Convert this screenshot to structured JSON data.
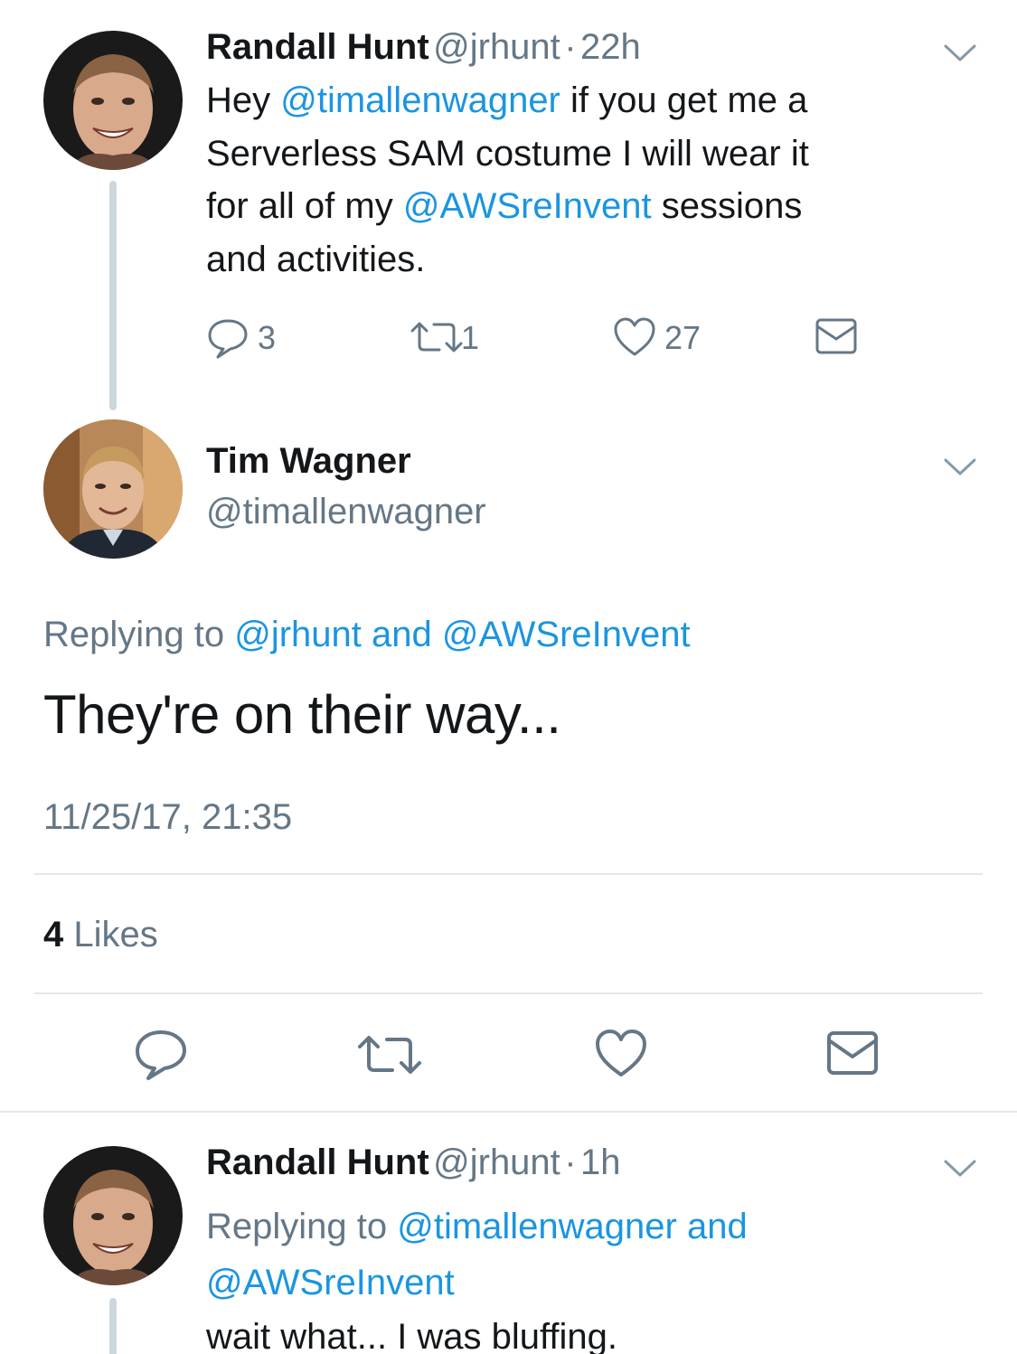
{
  "tweet1": {
    "name": "Randall Hunt",
    "handle": "@jrhunt",
    "sep": "·",
    "time": "22h",
    "text_parts": [
      "Hey ",
      "@timallenwagner",
      " if you get me a",
      "Serverless SAM costume I will wear it",
      "for all of my ",
      "@AWSreInvent",
      " sessions",
      "and activities."
    ],
    "replies": "3",
    "retweets": "1",
    "likes": "27"
  },
  "tweet2": {
    "name": "Tim Wagner",
    "handle": "@timallenwagner",
    "replying_prefix": "Replying to ",
    "replying_user1": "@jrhunt",
    "replying_and": " and ",
    "replying_user2": "@AWSreInvent",
    "text": "They're on their way...",
    "timestamp": "11/25/17, 21:35",
    "likes_count": "4",
    "likes_label": "Likes"
  },
  "tweet3": {
    "name": "Randall Hunt",
    "handle": "@jrhunt",
    "sep": "·",
    "time": "1h",
    "replying_prefix": "Replying to ",
    "replying_user1": "@timallenwagner",
    "replying_and": " and",
    "replying_user2": "@AWSreInvent",
    "text": "wait what... I was bluffing."
  },
  "colors": {
    "link": "#1b95e0",
    "grey": "#657786",
    "text": "#14171a",
    "divider": "#e1e8ed",
    "thread_line": "#ccd6dd"
  },
  "icons": {
    "reply": "reply-icon",
    "retweet": "retweet-icon",
    "like": "heart-icon",
    "dm": "envelope-icon",
    "caret": "chevron-down-icon"
  }
}
